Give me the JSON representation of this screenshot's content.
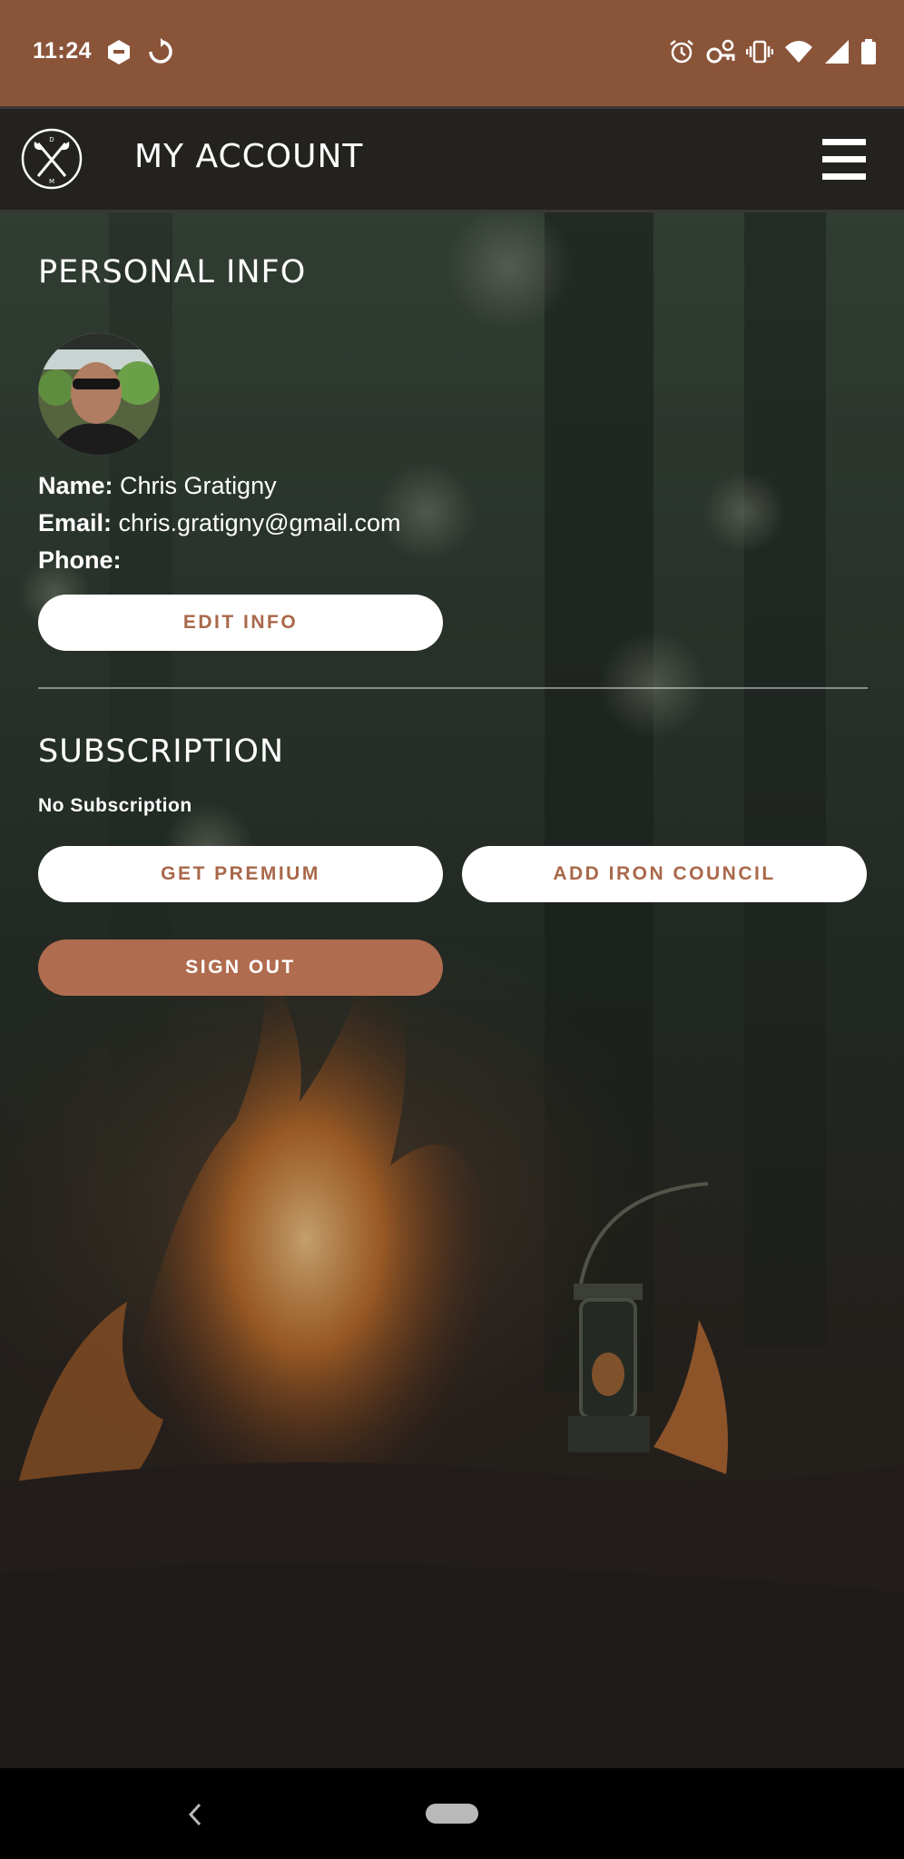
{
  "status_bar": {
    "time": "11:24",
    "left_icons": [
      "app-notification-icon",
      "sync-icon"
    ],
    "right_icons": [
      "alarm-icon",
      "vpn-key-icon",
      "vibrate-icon",
      "wifi-icon",
      "signal-icon",
      "battery-icon"
    ]
  },
  "app_bar": {
    "title": "MY ACCOUNT",
    "logo_icon": "crossed-axes-logo-icon",
    "menu_icon": "hamburger-menu-icon"
  },
  "personal_info": {
    "heading": "PERSONAL INFO",
    "name_label": "Name:",
    "name_value": "Chris Gratigny",
    "email_label": "Email:",
    "email_value": "chris.gratigny@gmail.com",
    "phone_label": "Phone:",
    "phone_value": "",
    "edit_button": "EDIT INFO"
  },
  "subscription": {
    "heading": "SUBSCRIPTION",
    "status": "No Subscription",
    "get_premium_button": "GET PREMIUM",
    "add_iron_council_button": "ADD IRON COUNCIL"
  },
  "sign_out_button": "SIGN OUT",
  "colors": {
    "status_bar": "#8a5439",
    "app_bar": "#23221f",
    "accent": "#b06c4f",
    "button_text": "#a9684a"
  }
}
